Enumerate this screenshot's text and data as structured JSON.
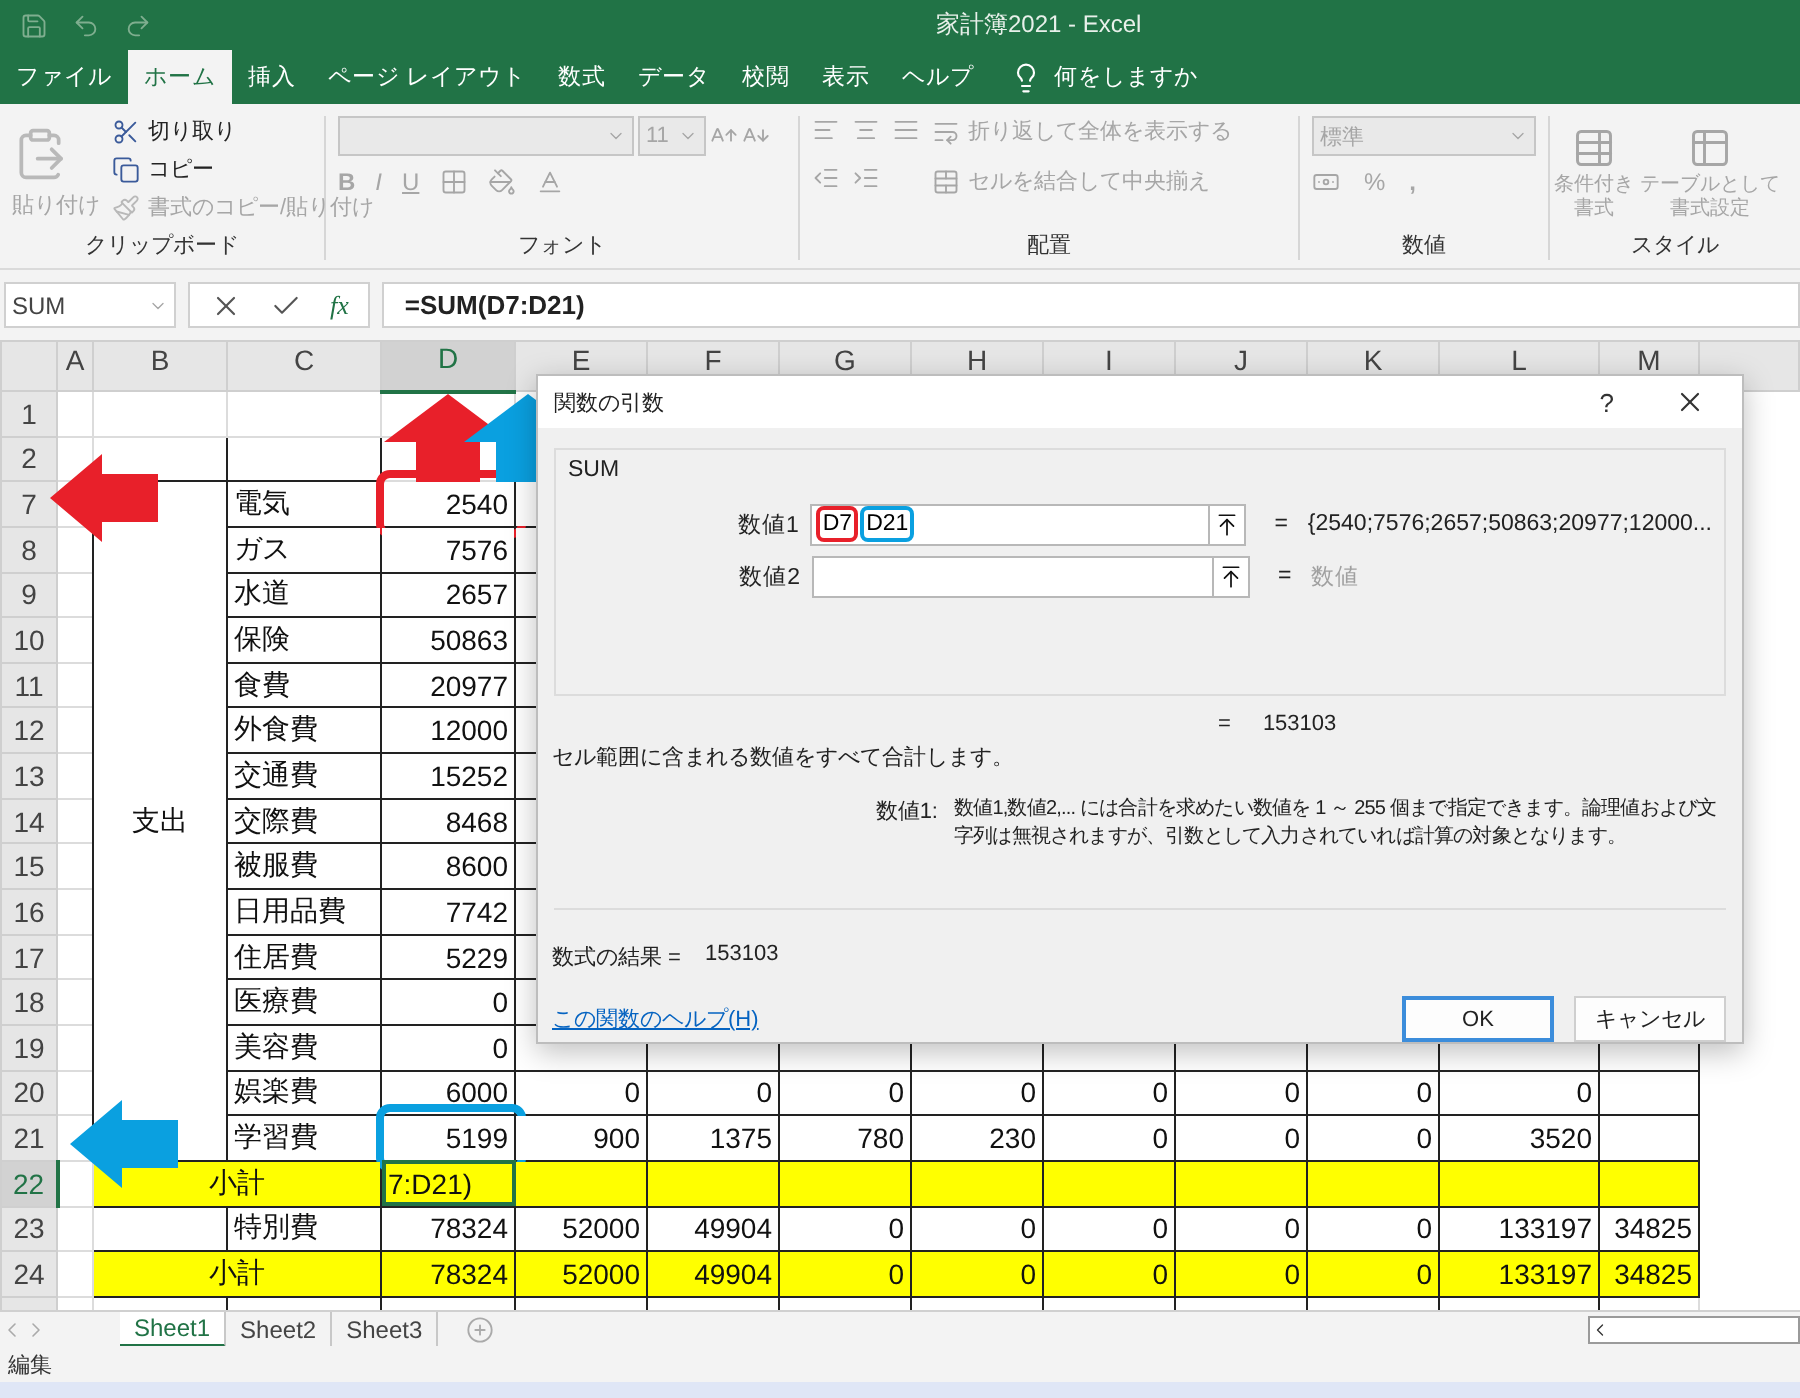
{
  "window": {
    "title": "家計簿2021  -  Excel"
  },
  "ribbon_tabs": [
    {
      "label": "ファイル",
      "selected": false
    },
    {
      "label": "ホーム",
      "selected": true
    },
    {
      "label": "挿入",
      "selected": false
    },
    {
      "label": "ページ レイアウト",
      "selected": false
    },
    {
      "label": "数式",
      "selected": false
    },
    {
      "label": "データ",
      "selected": false
    },
    {
      "label": "校閲",
      "selected": false
    },
    {
      "label": "表示",
      "selected": false
    },
    {
      "label": "ヘルプ",
      "selected": false
    }
  ],
  "tell_me": {
    "placeholder": "何をしますか"
  },
  "clipboard": {
    "label": "クリップボード",
    "paste": {
      "label": "貼り付け",
      "disabled": true
    },
    "items": [
      {
        "kind": "cut",
        "label": "切り取り",
        "disabled": false
      },
      {
        "kind": "copy",
        "label": "コピー",
        "disabled": false
      },
      {
        "kind": "format",
        "label": "書式のコピー/貼り付け",
        "disabled": true
      }
    ]
  },
  "font": {
    "label": "フォント",
    "size": "11",
    "style_buttons": [
      "B",
      "I",
      "U"
    ]
  },
  "alignment": {
    "label": "配置",
    "wrap": "折り返して全体を表示する",
    "merge": "セルを結合して中央揃え"
  },
  "number": {
    "label": "数値",
    "format": "標準",
    "percent": "%",
    "comma": ","
  },
  "styles": {
    "label": "スタイル",
    "buttons": [
      "条件付き書式",
      "テーブルとして書式設定"
    ]
  },
  "formula_bar": {
    "name_box": "SUM",
    "fx": "fx",
    "formula": "=SUM(D7:D21)"
  },
  "columns": [
    {
      "label": "A",
      "selected": false
    },
    {
      "label": "B",
      "selected": false
    },
    {
      "label": "C",
      "selected": false
    },
    {
      "label": "D",
      "selected": true
    },
    {
      "label": "E",
      "selected": false
    },
    {
      "label": "F",
      "selected": false
    },
    {
      "label": "G",
      "selected": false
    },
    {
      "label": "H",
      "selected": false
    },
    {
      "label": "I",
      "selected": false
    },
    {
      "label": "J",
      "selected": false
    },
    {
      "label": "K",
      "selected": false
    },
    {
      "label": "L",
      "selected": false
    },
    {
      "label": "M",
      "selected": false
    }
  ],
  "rows": [
    {
      "kind": "blank",
      "header": "1",
      "selected": false
    },
    {
      "kind": "boxed",
      "header": "2",
      "selected": false
    },
    {
      "kind": "section",
      "label": "支出",
      "children": [
        {
          "kind": "item",
          "header": "7",
          "item": "電気",
          "amount": "2540",
          "selected": false,
          "color": "#e8202a"
        },
        {
          "kind": "item",
          "header": "8",
          "item": "ガス",
          "amount": "7576",
          "selected": false
        },
        {
          "kind": "item",
          "header": "9",
          "item": "水道",
          "amount": "2657",
          "selected": false
        },
        {
          "kind": "item",
          "header": "10",
          "item": "保険",
          "amount": "50863",
          "selected": false
        },
        {
          "kind": "item",
          "header": "11",
          "item": "食費",
          "amount": "20977",
          "selected": false
        },
        {
          "kind": "item",
          "header": "12",
          "item": "外食費",
          "amount": "12000",
          "selected": false
        },
        {
          "kind": "item",
          "header": "13",
          "item": "交通費",
          "amount": "15252",
          "selected": false
        },
        {
          "kind": "item",
          "header": "14",
          "item": "交際費",
          "amount": "8468",
          "selected": false
        },
        {
          "kind": "item",
          "header": "15",
          "item": "被服費",
          "amount": "8600",
          "selected": false
        },
        {
          "kind": "item",
          "header": "16",
          "item": "日用品費",
          "amount": "7742",
          "selected": false
        },
        {
          "kind": "item",
          "header": "17",
          "item": "住居費",
          "amount": "5229",
          "selected": false
        },
        {
          "kind": "item",
          "header": "18",
          "item": "医療費",
          "amount": "0",
          "selected": false
        },
        {
          "kind": "item",
          "header": "19",
          "item": "美容費",
          "amount": "0",
          "selected": false
        },
        {
          "kind": "item",
          "header": "20",
          "item": "娯楽費",
          "amount": "6000",
          "selected": false,
          "others": [
            "0",
            "0",
            "0",
            "0",
            "0",
            "0",
            "0",
            "0"
          ]
        },
        {
          "kind": "item",
          "header": "21",
          "item": "学習費",
          "amount": "5199",
          "selected": false,
          "color": "#0aa0e0",
          "others": [
            "900",
            "1375",
            "780",
            "230",
            "0",
            "0",
            "0",
            "3520"
          ]
        }
      ]
    },
    {
      "kind": "subtotal",
      "header": "22",
      "label": "小計",
      "amount": "7:D21)",
      "selected": true
    },
    {
      "kind": "item",
      "header": "23",
      "item": "特別費",
      "amount": "78324",
      "selected": false,
      "others": [
        "52000",
        "49904",
        "0",
        "0",
        "0",
        "0",
        "0",
        "133197",
        "34825"
      ]
    },
    {
      "kind": "subtotal",
      "header": "24",
      "label": "小計",
      "amount": "78324",
      "selected": false,
      "others": [
        "52000",
        "49904",
        "0",
        "0",
        "0",
        "0",
        "0",
        "133197",
        "34825"
      ]
    }
  ],
  "annotations": [
    {
      "kind": "arrow-up",
      "color": "#e8202a"
    },
    {
      "kind": "arrow-up",
      "color": "#0aa0e0"
    },
    {
      "kind": "arrow-left",
      "color": "#e8202a"
    },
    {
      "kind": "arrow-left",
      "color": "#0aa0e0"
    }
  ],
  "dialog": {
    "title": "関数の引数",
    "help_button": "?",
    "function": "SUM",
    "args": [
      {
        "label": "数値1",
        "parts": [
          {
            "text": "D7",
            "color": "#e8202a"
          },
          {
            "text": "D21",
            "color": "#0aa0e0"
          }
        ],
        "result": "{2540;7576;2657;50863;20977;12000...",
        "kind": "value"
      },
      {
        "label": "数値2",
        "result": "数値",
        "kind": "hint"
      }
    ],
    "equals": "=",
    "total": "153103",
    "description": "セル範囲に含まれる数値をすべて合計します。",
    "arg_help_label": "数値1:",
    "arg_help": "数値1,数値2,... には合計を求めたい数値を 1 ～ 255 個まで指定できます。論理値および文字列は無視されますが、引数として入力されていれば計算の対象となります。",
    "result_label": "数式の結果 =",
    "result": "153103",
    "help_link": "この関数のヘルプ(H)",
    "ok": "OK",
    "cancel": "キャンセル"
  },
  "sheets": [
    {
      "label": "Sheet1",
      "selected": true
    },
    {
      "label": "Sheet2",
      "selected": false
    },
    {
      "label": "Sheet3",
      "selected": false
    }
  ],
  "status": "編集"
}
